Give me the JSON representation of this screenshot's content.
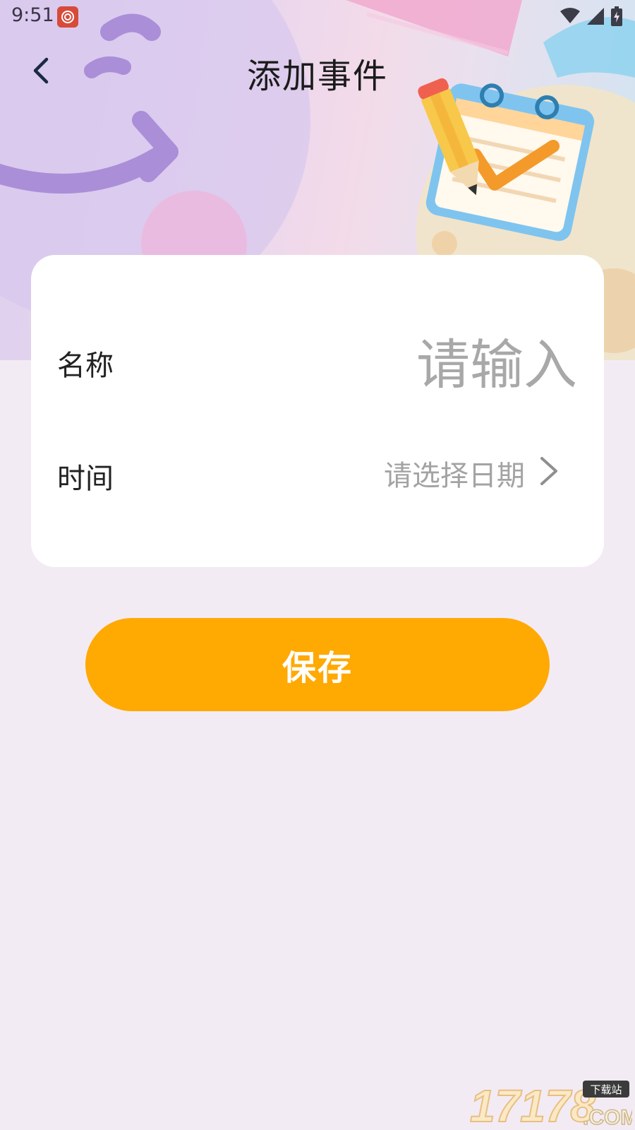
{
  "status_bar": {
    "time": "9:51",
    "icons": [
      "app-notification-icon",
      "wifi-icon",
      "cellular-signal-icon",
      "battery-charging-icon"
    ]
  },
  "header": {
    "title": "添加事件",
    "back_icon": "back-arrow-icon"
  },
  "form": {
    "name": {
      "label": "名称",
      "placeholder": "请输入",
      "value": ""
    },
    "time": {
      "label": "时间",
      "value": "请选择日期",
      "icon": "chevron-right-icon"
    }
  },
  "actions": {
    "save_label": "保存"
  },
  "watermark": {
    "text": "17178",
    "suffix": "COM",
    "tag": "下载站"
  },
  "colors": {
    "accent": "#ffa903",
    "background": "#f3ebf4",
    "card": "#ffffff",
    "placeholder": "#a8a8a8"
  }
}
